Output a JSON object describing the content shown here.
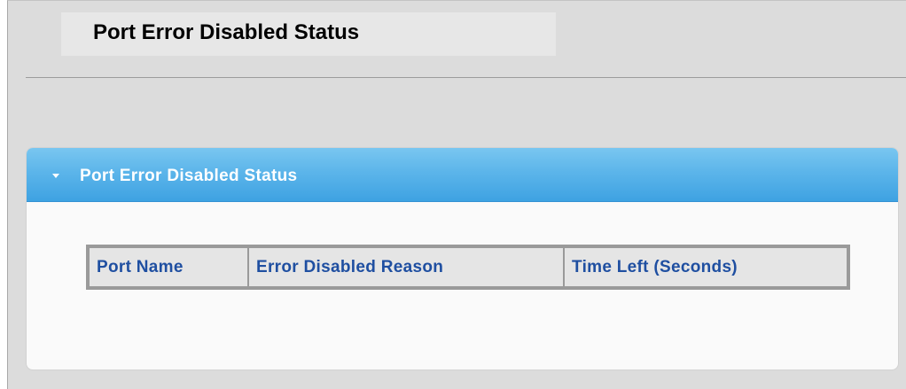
{
  "page": {
    "title": "Port Error Disabled Status"
  },
  "panel": {
    "title": "Port Error Disabled Status",
    "collapse_icon": "triangle-down-icon"
  },
  "table": {
    "columns": [
      {
        "label": "Port Name"
      },
      {
        "label": "Error Disabled Reason"
      },
      {
        "label": "Time Left (Seconds)"
      }
    ],
    "rows": []
  },
  "colors": {
    "header_gradient_top": "#79c6f0",
    "header_gradient_bottom": "#3ea2e2",
    "column_text": "#1f4fa1",
    "background": "#dcdcdc"
  }
}
